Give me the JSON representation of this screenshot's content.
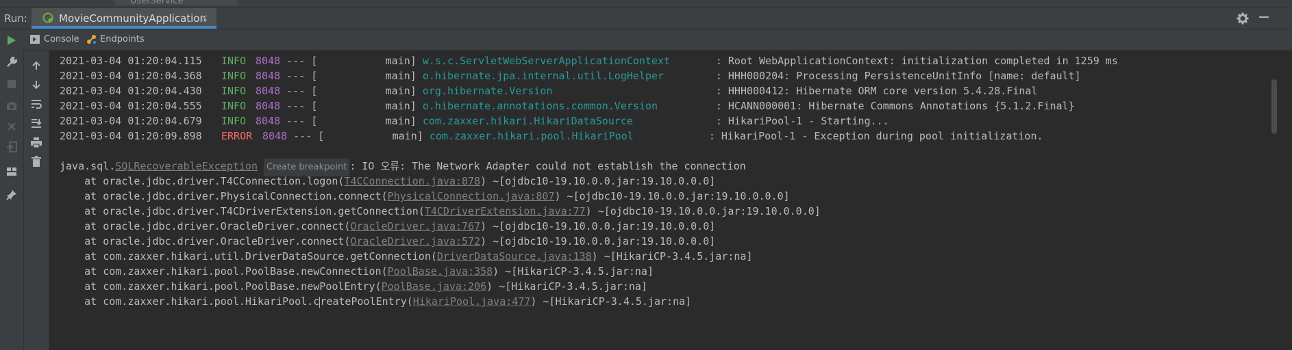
{
  "top": {
    "ghost_text": "UserService"
  },
  "run_panel": {
    "label": "Run:",
    "tab_title": "MovieCommunityApplication",
    "close_symbol": "×"
  },
  "subtabs": {
    "console": "Console",
    "endpoints": "Endpoints"
  },
  "colors": {
    "info": "#5ead5c",
    "error": "#ff6b68",
    "pid": "#a871c6",
    "logger": "#299999",
    "accent": "#4a88c7"
  },
  "logs": [
    {
      "ts": "2021-03-04 01:20:04.115",
      "level": "INFO",
      "pid": "8048",
      "sep": "--- [",
      "thread": "           main]",
      "logger": "w.s.c.ServletWebServerApplicationContext",
      "msg": ": Root WebApplicationContext: initialization completed in 1259 ms"
    },
    {
      "ts": "2021-03-04 01:20:04.368",
      "level": "INFO",
      "pid": "8048",
      "sep": "--- [",
      "thread": "           main]",
      "logger": "o.hibernate.jpa.internal.util.LogHelper",
      "msg": ": HHH000204: Processing PersistenceUnitInfo [name: default]"
    },
    {
      "ts": "2021-03-04 01:20:04.430",
      "level": "INFO",
      "pid": "8048",
      "sep": "--- [",
      "thread": "           main]",
      "logger": "org.hibernate.Version",
      "msg": ": HHH000412: Hibernate ORM core version 5.4.28.Final"
    },
    {
      "ts": "2021-03-04 01:20:04.555",
      "level": "INFO",
      "pid": "8048",
      "sep": "--- [",
      "thread": "           main]",
      "logger": "o.hibernate.annotations.common.Version",
      "msg": ": HCANN000001: Hibernate Commons Annotations {5.1.2.Final}"
    },
    {
      "ts": "2021-03-04 01:20:04.679",
      "level": "INFO",
      "pid": "8048",
      "sep": "--- [",
      "thread": "           main]",
      "logger": "com.zaxxer.hikari.HikariDataSource",
      "msg": ": HikariPool-1 - Starting..."
    },
    {
      "ts": "2021-03-04 01:20:09.898",
      "level": "ERROR",
      "pid": "8048",
      "sep": "--- [",
      "thread": "           main]",
      "logger": "com.zaxxer.hikari.pool.HikariPool",
      "msg": ": HikariPool-1 - Exception during pool initialization."
    }
  ],
  "exception": {
    "prefix": "java.sql.",
    "name": "SQLRecoverableException",
    "breakpoint_label": "Create breakpoint",
    "message": ": IO 오류: The Network Adapter could not establish the connection"
  },
  "stack": [
    {
      "pre": "    at oracle.jdbc.driver.T4CConnection.logon(",
      "link": "T4CConnection.java:878",
      "post": ") ~[ojdbc10-19.10.0.0.jar:19.10.0.0.0]"
    },
    {
      "pre": "    at oracle.jdbc.driver.PhysicalConnection.connect(",
      "link": "PhysicalConnection.java:807",
      "post": ") ~[ojdbc10-19.10.0.0.jar:19.10.0.0.0]"
    },
    {
      "pre": "    at oracle.jdbc.driver.T4CDriverExtension.getConnection(",
      "link": "T4CDriverExtension.java:77",
      "post": ") ~[ojdbc10-19.10.0.0.jar:19.10.0.0.0]"
    },
    {
      "pre": "    at oracle.jdbc.driver.OracleDriver.connect(",
      "link": "OracleDriver.java:767",
      "post": ") ~[ojdbc10-19.10.0.0.jar:19.10.0.0.0]"
    },
    {
      "pre": "    at oracle.jdbc.driver.OracleDriver.connect(",
      "link": "OracleDriver.java:572",
      "post": ") ~[ojdbc10-19.10.0.0.jar:19.10.0.0.0]"
    },
    {
      "pre": "    at com.zaxxer.hikari.util.DriverDataSource.getConnection(",
      "link": "DriverDataSource.java:138",
      "post": ") ~[HikariCP-3.4.5.jar:na]"
    },
    {
      "pre": "    at com.zaxxer.hikari.pool.PoolBase.newConnection(",
      "link": "PoolBase.java:358",
      "post": ") ~[HikariCP-3.4.5.jar:na]"
    },
    {
      "pre": "    at com.zaxxer.hikari.pool.PoolBase.newPoolEntry(",
      "link": "PoolBase.java:206",
      "post": ") ~[HikariCP-3.4.5.jar:na]"
    }
  ],
  "partial_line": {
    "pre": "    at com.zaxxer.hikari.pool.HikariPool.c",
    "mid": "reatePoolEntry(",
    "link": "HikariPool.java:477",
    "post": ") ~[HikariCP-3.4.5.jar:na]"
  }
}
